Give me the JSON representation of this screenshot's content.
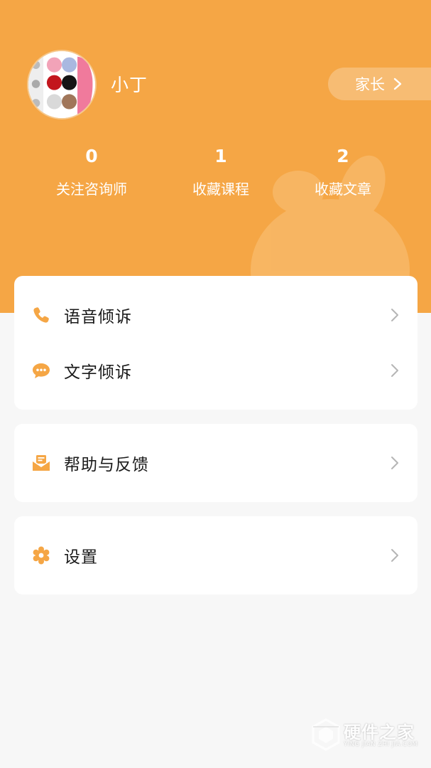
{
  "profile": {
    "name": "小丁",
    "role_button": "家长"
  },
  "stats": [
    {
      "count": "0",
      "label": "关注咨询师"
    },
    {
      "count": "1",
      "label": "收藏课程"
    },
    {
      "count": "2",
      "label": "收藏文章"
    }
  ],
  "menu": {
    "voice": "语音倾诉",
    "text": "文字倾诉",
    "help": "帮助与反馈",
    "settings": "设置"
  },
  "watermark": {
    "title": "硬件之家",
    "subtitle": "YING JIAN ZHI JIA.COM"
  },
  "colors": {
    "header": "#f5a645",
    "icon": "#f5a645",
    "background": "#f7f7f7"
  }
}
